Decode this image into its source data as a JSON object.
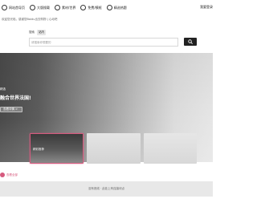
{
  "nav": {
    "items": [
      {
        "label": "网站首导页",
        "icon": "home-icon"
      },
      {
        "label": "大版搜载",
        "icon": "layout-icon"
      },
      {
        "label": "素材/世界",
        "icon": "globe-icon"
      },
      {
        "label": "免费/模框",
        "icon": "gift-icon"
      },
      {
        "label": "精选热题",
        "icon": "star-icon"
      }
    ],
    "login_label": "我要登录"
  },
  "breadcrumb": "欢迎您光临，感谢您Baidu出去购物 | 心动吧",
  "search": {
    "tabs": [
      "搜索",
      "站内"
    ],
    "placeholder": "请搜索你想要的",
    "button_icon": "search-icon"
  },
  "hero": {
    "tag": "精选",
    "title": "融合世界法国!",
    "cta": "查看详情 >"
  },
  "cards": [
    {
      "label": "精彩推荐"
    },
    {
      "label": ""
    },
    {
      "label": ""
    }
  ],
  "bottom_tag": "查看全部",
  "footer_text": "没有底线 · 此处上有连接块点",
  "colors": {
    "accent": "#d65a7e",
    "dark": "#222222",
    "footer_bg": "#e8e8e8"
  }
}
